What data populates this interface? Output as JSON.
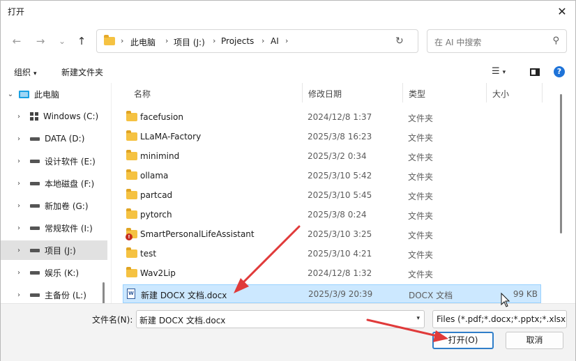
{
  "window": {
    "title": "打开",
    "close_glyph": "✕"
  },
  "nav": {
    "back": "←",
    "forward": "→",
    "recent": "⌄",
    "up": "↑",
    "breadcrumbs": [
      "此电脑",
      "项目 (J:)",
      "Projects",
      "AI"
    ],
    "sep": "›",
    "refresh": "↻",
    "search_placeholder": "在 AI 中搜索",
    "search_glyph": "⚲"
  },
  "toolbar": {
    "organize": "组织",
    "new_folder": "新建文件夹",
    "caret": "▾",
    "view_glyph": "☰",
    "help": "?"
  },
  "sidebar": {
    "items": [
      {
        "label": "此电脑",
        "chev": "⌄",
        "icon": "pc"
      },
      {
        "label": "Windows (C:)",
        "chev": "›",
        "icon": "win"
      },
      {
        "label": "DATA (D:)",
        "chev": "›",
        "icon": "drive"
      },
      {
        "label": "设计软件 (E:)",
        "chev": "›",
        "icon": "drive"
      },
      {
        "label": "本地磁盘 (F:)",
        "chev": "›",
        "icon": "drive"
      },
      {
        "label": "新加卷 (G:)",
        "chev": "›",
        "icon": "drive"
      },
      {
        "label": "常规软件 (I:)",
        "chev": "›",
        "icon": "drive"
      },
      {
        "label": "项目 (J:)",
        "chev": "›",
        "icon": "drive",
        "selected": true
      },
      {
        "label": "娱乐 (K:)",
        "chev": "›",
        "icon": "drive"
      },
      {
        "label": "主备份 (L:)",
        "chev": "›",
        "icon": "drive"
      }
    ]
  },
  "columns": {
    "name": "名称",
    "date": "修改日期",
    "type": "类型",
    "size": "大小",
    "sort_glyph": "⌃"
  },
  "files": [
    {
      "name": "facefusion",
      "date": "2024/12/8 1:37",
      "type": "文件夹",
      "size": "",
      "icon": "folder"
    },
    {
      "name": "LLaMA-Factory",
      "date": "2025/3/8 16:23",
      "type": "文件夹",
      "size": "",
      "icon": "folder"
    },
    {
      "name": "minimind",
      "date": "2025/3/2 0:34",
      "type": "文件夹",
      "size": "",
      "icon": "folder"
    },
    {
      "name": "ollama",
      "date": "2025/3/10 5:42",
      "type": "文件夹",
      "size": "",
      "icon": "folder"
    },
    {
      "name": "partcad",
      "date": "2025/3/10 5:45",
      "type": "文件夹",
      "size": "",
      "icon": "folder"
    },
    {
      "name": "pytorch",
      "date": "2025/3/8 0:24",
      "type": "文件夹",
      "size": "",
      "icon": "folder"
    },
    {
      "name": "SmartPersonalLifeAssistant",
      "date": "2025/3/10 3:25",
      "type": "文件夹",
      "size": "",
      "icon": "folder-warning"
    },
    {
      "name": "test",
      "date": "2025/3/10 4:21",
      "type": "文件夹",
      "size": "",
      "icon": "folder"
    },
    {
      "name": "Wav2Lip",
      "date": "2024/12/8 1:32",
      "type": "文件夹",
      "size": "",
      "icon": "folder"
    },
    {
      "name": "新建 DOCX 文档.docx",
      "date": "2025/3/9 20:39",
      "type": "DOCX 文档",
      "size": "99 KB",
      "icon": "docx",
      "selected": true
    }
  ],
  "footer": {
    "filename_label": "文件名(N):",
    "filename_value": "新建 DOCX 文档.docx",
    "filter_value": "Files (*.pdf;*.docx;*.pptx;*.xlsx",
    "open_button": "打开(O)",
    "cancel_button": "取消"
  },
  "colors": {
    "selection": "#cce8ff",
    "accent": "#2f7ec9",
    "arrow": "#e03a3a",
    "folder": "#f5c242"
  }
}
